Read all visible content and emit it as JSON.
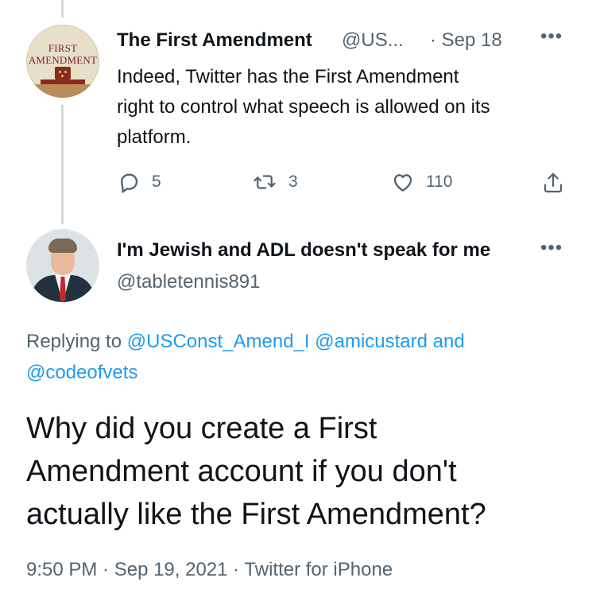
{
  "parent_tweet": {
    "avatar_text": [
      "FIRST",
      "AMENDMENT"
    ],
    "display_name": "The First Amendment",
    "handle": "@US...",
    "date": "· Sep 18",
    "more": "•••",
    "body_lines": [
      "Indeed, Twitter has the First Amendment",
      "right to control what speech is allowed on its",
      "platform."
    ],
    "actions": {
      "reply_icon": "reply-icon",
      "reply_count": "5",
      "retweet_icon": "retweet-icon",
      "retweet_count": "3",
      "like_icon": "like-icon",
      "like_count": "110",
      "share_icon": "share-icon"
    }
  },
  "main_tweet": {
    "display_name": "I'm Jewish and ADL doesn't speak for me",
    "handle": "@tabletennis891",
    "more": "•••",
    "replying_to": {
      "prefix": "Replying to",
      "mention_1": "@USConst_Amend_I",
      "mention_2": "@amicustard",
      "conjunction": "and",
      "mention_3": "@codeofvets"
    },
    "body_lines": [
      "Why did you create a First",
      "Amendment account if you don't",
      "actually like the First Amendment?"
    ],
    "meta": "9:50 PM · Sep 19, 2021 · Twitter for iPhone"
  },
  "colors": {
    "text": "#0f1419",
    "secondary": "#536471",
    "link": "#1d9bf0",
    "thread_line": "#cfd9de"
  }
}
